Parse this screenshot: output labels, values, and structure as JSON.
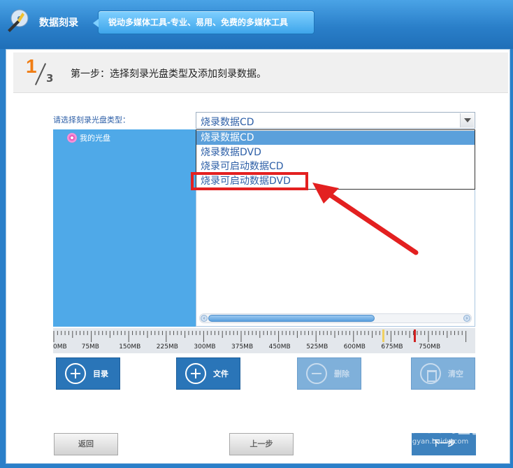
{
  "titlebar": {
    "app_title": "数据刻录",
    "slogan": "锐动多媒体工具-专业、易用、免费的多媒体工具"
  },
  "step": {
    "current": "1",
    "total": "3",
    "text": "第一步：选择刻录光盘类型及添加刻录数据。"
  },
  "disc_type": {
    "label": "请选择刻录光盘类型：",
    "selected": "烧录数据CD",
    "options": [
      "烧录数据CD",
      "烧录数据DVD",
      "烧录可启动数据CD",
      "烧录可启动数据DVD"
    ],
    "highlighted_option": "烧录可启动数据DVD"
  },
  "tree": {
    "root": "我的光盘"
  },
  "ruler": {
    "labels": [
      "0MB",
      "75MB",
      "150MB",
      "225MB",
      "300MB",
      "375MB",
      "450MB",
      "525MB",
      "600MB",
      "675MB",
      "750MB"
    ]
  },
  "actions": {
    "folder": "目录",
    "file": "文件",
    "delete": "删除",
    "clear": "清空"
  },
  "nav": {
    "back": "返回",
    "prev": "上一步",
    "next": "下一步"
  },
  "watermark": {
    "main": "Bai du 经验",
    "sub": "jingyan.baidu.com"
  },
  "colors": {
    "accent": "#2a75b8",
    "highlight": "#e32020",
    "step_number": "#f07d14"
  }
}
